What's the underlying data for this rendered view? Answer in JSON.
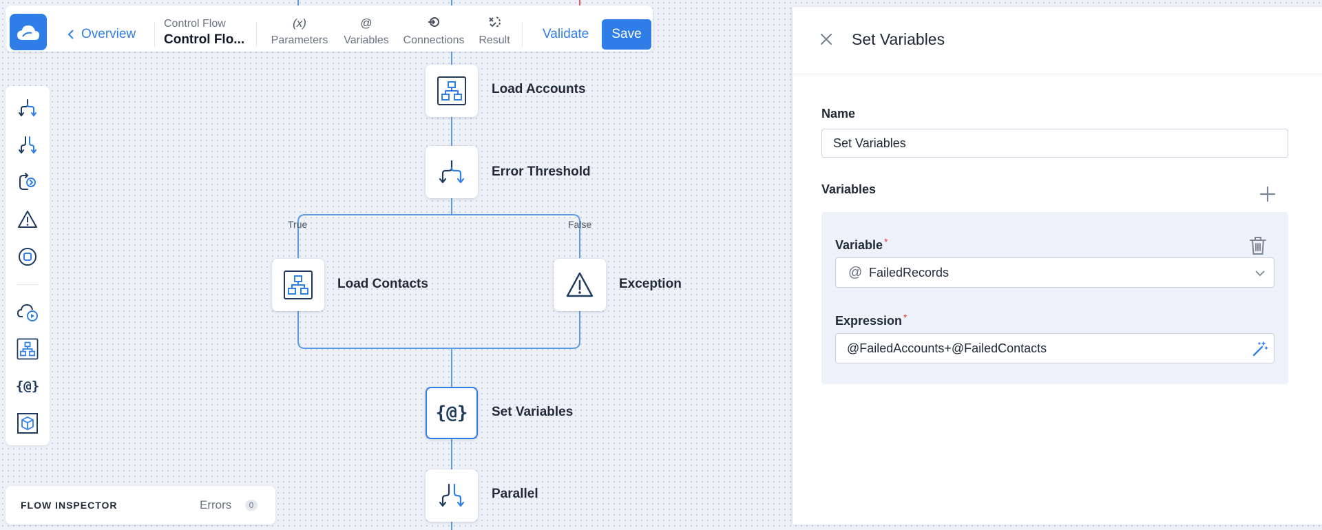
{
  "toolbar": {
    "overview_label": "Overview",
    "flow_type": "Control Flow",
    "flow_name": "Control Flo...",
    "items": [
      {
        "icon": "(x)",
        "label": "Parameters"
      },
      {
        "icon": "@",
        "label": "Variables"
      },
      {
        "icon": "connections-icon",
        "label": "Connections"
      },
      {
        "icon": "result-icon",
        "label": "Result"
      }
    ],
    "validate_label": "Validate",
    "save_label": "Save"
  },
  "palette": {
    "items": [
      "fork-icon",
      "branch-icon",
      "loop-icon",
      "exception-icon",
      "stop-icon",
      "cloud-play-icon",
      "data-flow-icon",
      "set-variables-icon",
      "box-icon"
    ]
  },
  "flow": {
    "nodes": {
      "load_accounts": "Load Accounts",
      "error_threshold": "Error Threshold",
      "load_contacts": "Load Contacts",
      "exception": "Exception",
      "set_variables": "Set Variables",
      "parallel": "Parallel"
    },
    "branches": {
      "true_label": "True",
      "false_label": "False"
    },
    "set_variables_glyph": "{@}"
  },
  "inspector": {
    "title": "FLOW INSPECTOR",
    "errors_label": "Errors",
    "errors_count": "0"
  },
  "panel": {
    "title": "Set Variables",
    "name_label": "Name",
    "name_value": "Set Variables",
    "variables_label": "Variables",
    "variable": {
      "label": "Variable",
      "required_mark": "*",
      "at": "@",
      "value": "FailedRecords",
      "expression_label": "Expression",
      "expression_value": "@FailedAccounts+@FailedContacts"
    }
  },
  "colors": {
    "accent": "#2f7ee8",
    "canvas": "#eef1f8",
    "line": "#5b9be6",
    "required": "#e03e3e"
  }
}
